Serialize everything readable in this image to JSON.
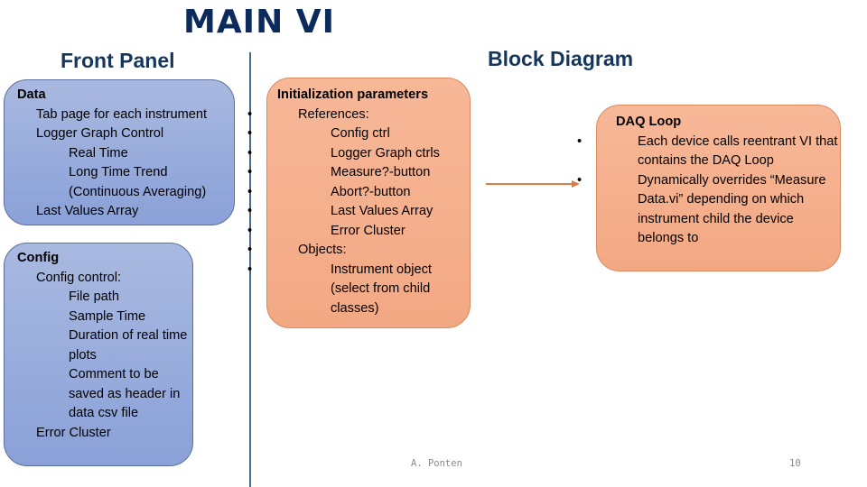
{
  "slide": {
    "title": "MAIN VI",
    "front_panel_heading": "Front Panel",
    "block_diagram_heading": "Block Diagram",
    "footer_author": "A. Ponten",
    "page_number": "10"
  },
  "front_panel": {
    "data_box": {
      "title": "Data",
      "items": [
        {
          "text": "Tab page for each instrument",
          "level": 1
        },
        {
          "text": "Logger Graph Control",
          "level": 1
        },
        {
          "text": "Real Time",
          "level": 2
        },
        {
          "text": "Long Time Trend (Continuous Averaging)",
          "level": 2
        },
        {
          "text": "Last Values Array",
          "level": 1
        }
      ]
    },
    "config_box": {
      "title": "Config",
      "items": [
        {
          "text": "Config control:",
          "level": 1
        },
        {
          "text": "File path",
          "level": 2
        },
        {
          "text": "Sample Time",
          "level": 2
        },
        {
          "text": "Duration of real time plots",
          "level": 2
        },
        {
          "text": "Comment to be saved as header in data csv file",
          "level": 2
        },
        {
          "text": "Error Cluster",
          "level": 1
        }
      ]
    }
  },
  "block_diagram": {
    "init_box": {
      "title": "Initialization parameters",
      "items": [
        {
          "text": "References:",
          "level": 1
        },
        {
          "text": "Config ctrl",
          "level": 2
        },
        {
          "text": "Logger Graph ctrls",
          "level": 2
        },
        {
          "text": "Measure?-button",
          "level": 2
        },
        {
          "text": "Abort?-button",
          "level": 2
        },
        {
          "text": "Last Values Array",
          "level": 2
        },
        {
          "text": "Error Cluster",
          "level": 2
        },
        {
          "text": "Objects:",
          "level": 1
        },
        {
          "text": "Instrument object (select from child classes)",
          "level": 2
        }
      ]
    },
    "daq_box": {
      "title": "DAQ Loop",
      "items": [
        {
          "text": "Each device calls reentrant VI that contains the DAQ Loop",
          "level": 1
        },
        {
          "text": "Dynamically overrides “Measure Data.vi” depending on which instrument child the device belongs to",
          "level": 1
        }
      ]
    }
  },
  "colors": {
    "title": "#0d2a5c",
    "heading": "#17365d",
    "front_panel_box": "#9aaedc",
    "block_diagram_box": "#f5ae8a",
    "arrow": "#e07b45"
  },
  "icons": {
    "arrow": "arrow-right-icon"
  }
}
